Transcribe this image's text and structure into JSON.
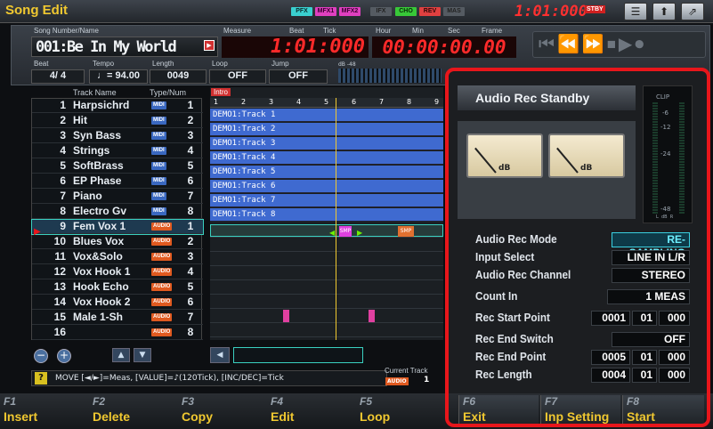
{
  "app": {
    "title": "Song Edit"
  },
  "fx_indicators": [
    {
      "label": "PFX",
      "color": "#3ad0d0"
    },
    {
      "label": "MFX1",
      "color": "#e040c0"
    },
    {
      "label": "MFX2",
      "color": "#e040c0"
    },
    {
      "label": "IFX",
      "color": "#555b62"
    },
    {
      "label": "CHO",
      "color": "#38c838"
    },
    {
      "label": "REV",
      "color": "#e04040"
    },
    {
      "label": "MAS",
      "color": "#555b62"
    }
  ],
  "clock": {
    "value": "1:01:000",
    "status": "STBY"
  },
  "header": {
    "song_label": "Song Number/Name",
    "song_value": "001:Be In My World",
    "measure_label": "Measure",
    "beat_label": "Beat",
    "tick_label": "Tick",
    "position_value": "1:01:000",
    "hour_label": "Hour",
    "min_label": "Min",
    "sec_label": "Sec",
    "frame_label": "Frame",
    "time_value": "00:00:00.00",
    "fields": [
      {
        "label": "Beat",
        "value": "4/ 4"
      },
      {
        "label": "Tempo",
        "value": "♩= 94.00"
      },
      {
        "label": "Length",
        "value": "0049"
      },
      {
        "label": "Loop",
        "value": "OFF"
      },
      {
        "label": "Jump",
        "value": "OFF"
      }
    ],
    "meter_label": "dB -48"
  },
  "track_list": {
    "col_track": "Track Name",
    "col_type": "Type/Num",
    "rows": [
      {
        "num": "1",
        "name": "Harpsichrd",
        "type": "MIDI",
        "ch": "1"
      },
      {
        "num": "2",
        "name": "Hit",
        "type": "MIDI",
        "ch": "2"
      },
      {
        "num": "3",
        "name": "Syn Bass",
        "type": "MIDI",
        "ch": "3"
      },
      {
        "num": "4",
        "name": "Strings",
        "type": "MIDI",
        "ch": "4"
      },
      {
        "num": "5",
        "name": "SoftBrass",
        "type": "MIDI",
        "ch": "5"
      },
      {
        "num": "6",
        "name": "EP Phase",
        "type": "MIDI",
        "ch": "6"
      },
      {
        "num": "7",
        "name": "Piano",
        "type": "MIDI",
        "ch": "7"
      },
      {
        "num": "8",
        "name": "Electro Gv",
        "type": "MIDI",
        "ch": "8"
      },
      {
        "num": "9",
        "name": "Fem Vox 1",
        "type": "AUDIO",
        "ch": "1"
      },
      {
        "num": "10",
        "name": "Blues Vox",
        "type": "AUDIO",
        "ch": "2"
      },
      {
        "num": "11",
        "name": "Vox&Solo",
        "type": "AUDIO",
        "ch": "3"
      },
      {
        "num": "12",
        "name": "Vox Hook 1",
        "type": "AUDIO",
        "ch": "4"
      },
      {
        "num": "13",
        "name": "Hook Echo",
        "type": "AUDIO",
        "ch": "5"
      },
      {
        "num": "14",
        "name": "Vox Hook 2",
        "type": "AUDIO",
        "ch": "6"
      },
      {
        "num": "15",
        "name": "Male 1-Sh",
        "type": "AUDIO",
        "ch": "7"
      },
      {
        "num": "16",
        "name": "",
        "type": "AUDIO",
        "ch": "8"
      }
    ]
  },
  "timeline": {
    "marker": "Intro",
    "measures": [
      "1",
      "2",
      "3",
      "4",
      "5",
      "6",
      "7",
      "8",
      "9"
    ],
    "lanes": [
      "DEMO1:Track 1",
      "DEMO1:Track 2",
      "DEMO1:Track 3",
      "DEMO1:Track 4",
      "DEMO1:Track 5",
      "DEMO1:Track 6",
      "DEMO1:Track 7",
      "DEMO1:Track 8"
    ],
    "clip_labels": [
      "SMP",
      "SMP"
    ]
  },
  "help_text": "MOVE [◄/►]=Meas, [VALUE]=♪(120Tick), [INC/DEC]=Tick",
  "current_track": {
    "label": "Current Track",
    "type": "AUDIO",
    "num": "1"
  },
  "panel": {
    "title": "Audio Rec Standby",
    "vu_unit": "dB",
    "clip_label": "CLIP",
    "meter_scale": [
      "-6",
      "-12",
      "-24",
      "-48"
    ],
    "meter_lr": "L  dB  R",
    "settings": [
      {
        "label": "Audio Rec Mode",
        "value": "RE-SAMPLING",
        "highlight": true
      },
      {
        "label": "Input Select",
        "value": "LINE IN L/R"
      },
      {
        "label": "Audio Rec Channel",
        "value": "STEREO"
      },
      {
        "label": "Count In",
        "value": "1 MEAS"
      },
      {
        "label": "Rec Start Point",
        "values": [
          "0001",
          "01",
          "000"
        ]
      },
      {
        "label": "Rec End Switch",
        "value": "OFF"
      },
      {
        "label": "Rec End Point",
        "values": [
          "0005",
          "01",
          "000"
        ]
      },
      {
        "label": "Rec Length",
        "values": [
          "0004",
          "01",
          "000"
        ]
      }
    ]
  },
  "fkeys": [
    {
      "key": "F1",
      "label": "Insert"
    },
    {
      "key": "F2",
      "label": "Delete"
    },
    {
      "key": "F3",
      "label": "Copy"
    },
    {
      "key": "F4",
      "label": "Edit"
    },
    {
      "key": "F5",
      "label": "Loop"
    },
    {
      "key": "F6",
      "label": "Exit"
    },
    {
      "key": "F7",
      "label": "Inp Setting"
    },
    {
      "key": "F8",
      "label": "Start"
    }
  ]
}
